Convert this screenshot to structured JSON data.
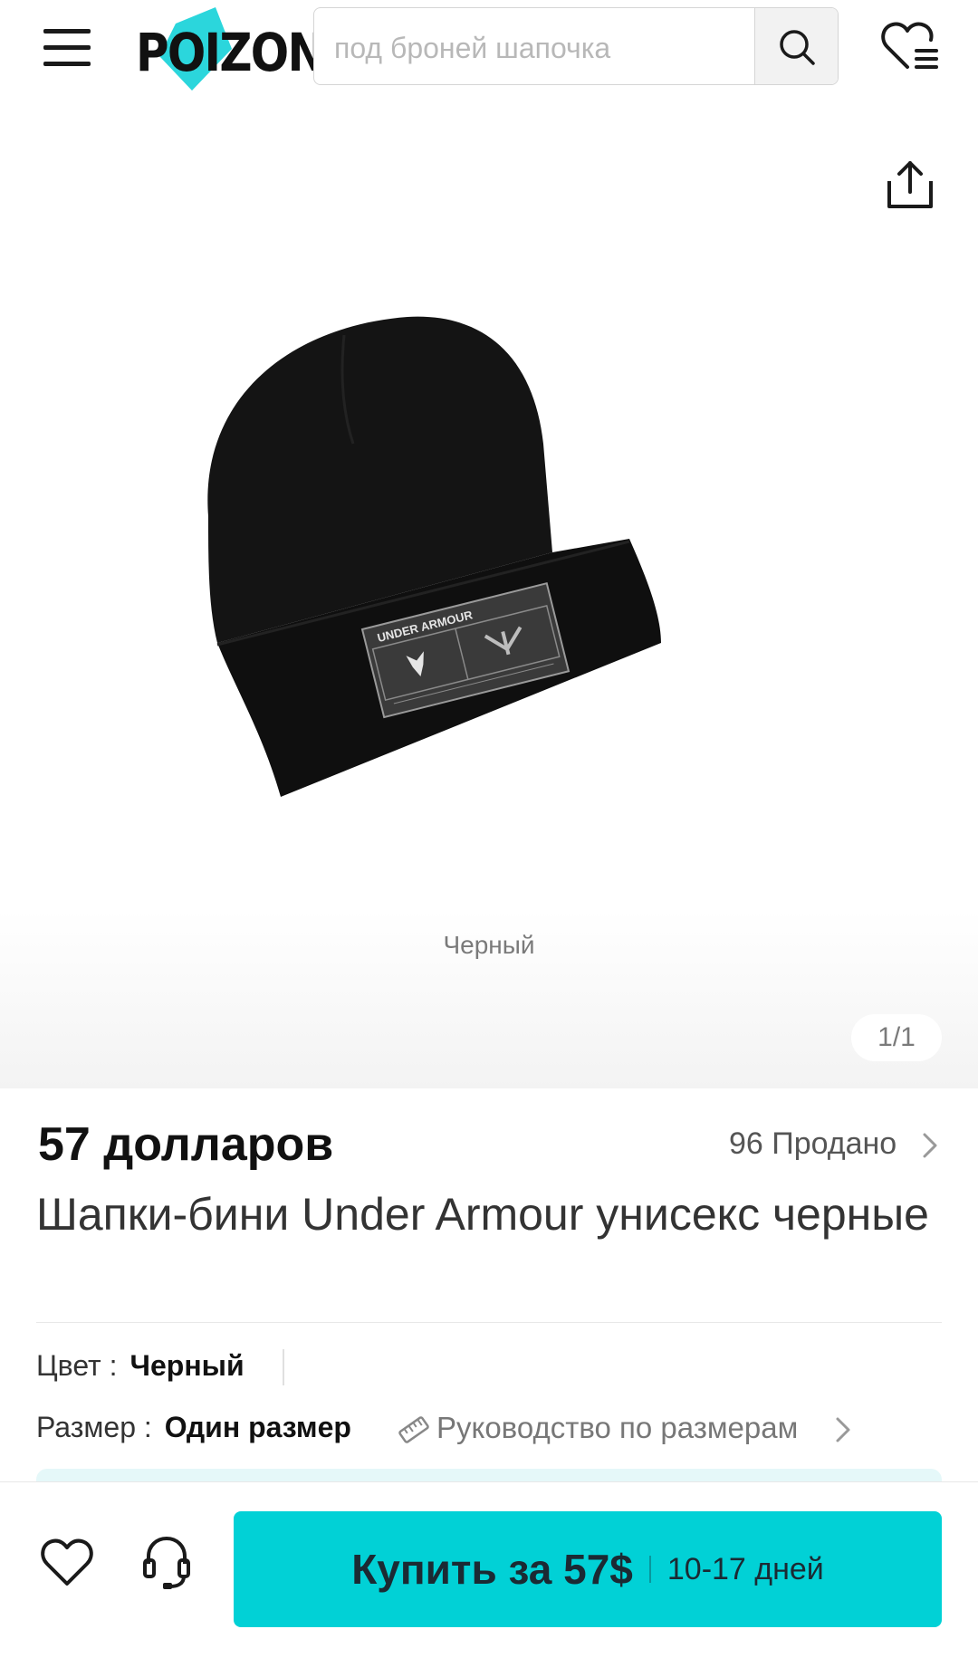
{
  "header": {
    "logo_text": "POIZON",
    "search_placeholder": "под броней шапочка",
    "icons": [
      "menu-icon",
      "search-icon",
      "wishlist-icon"
    ]
  },
  "gallery": {
    "share_icon": "share-icon",
    "color_caption": "Черный",
    "counter": "1/1",
    "product_label_text": "UNDER ARMOUR"
  },
  "product": {
    "price": "57 долларов",
    "sold": "96 Продано",
    "title": "Шапки-бини Under Armour унисекс черные",
    "color_label": "Цвет :",
    "color_value": "Черный",
    "size_label": "Размер :",
    "size_value": "Один размер",
    "size_guide": "Руководство по размерам"
  },
  "bottom_bar": {
    "buy_label": "Купить за 57$",
    "delivery": "10-17 дней",
    "accent_color": "#01d1d6"
  }
}
